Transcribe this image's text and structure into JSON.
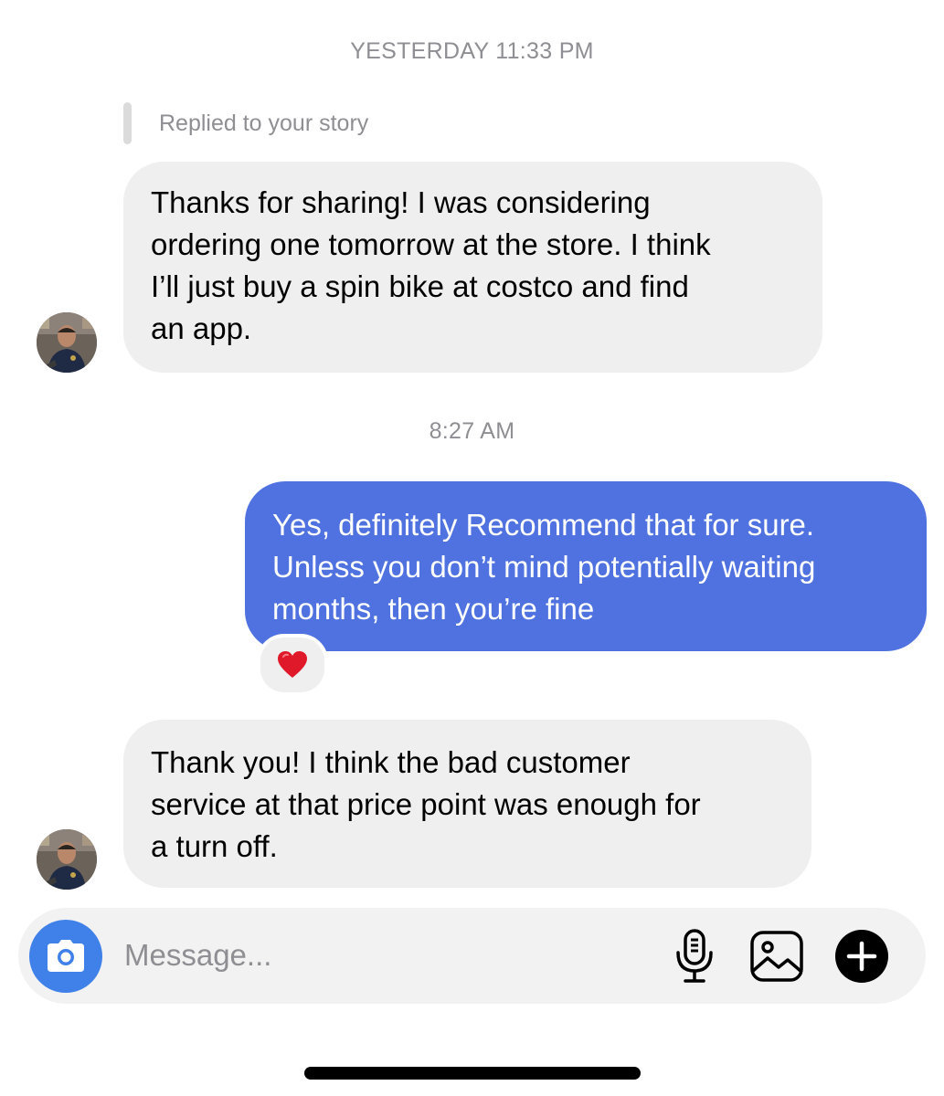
{
  "thread": {
    "timestamp_1": "YESTERDAY 11:33 PM",
    "reply_context": "Replied to your story",
    "timestamp_2": "8:27 AM"
  },
  "messages": [
    {
      "sender": "them",
      "text": "Thanks for sharing! I was considering\nordering one tomorrow at the store. I think\nI’ll just buy a spin bike at costco and find\nan app."
    },
    {
      "sender": "me",
      "text": "Yes, definitely Recommend that for sure.\nUnless you don’t mind potentially waiting\nmonths, then you’re fine",
      "reaction": "❤️"
    },
    {
      "sender": "them",
      "text": "Thank you! I think the bad customer\nservice at that price point was enough for\na turn off."
    }
  ],
  "composer": {
    "placeholder": "Message...",
    "camera_icon": "camera-icon",
    "mic_icon": "microphone-icon",
    "gallery_icon": "gallery-icon",
    "plus_icon": "plus-icon"
  },
  "colors": {
    "outgoing_bubble": "#4f72e0",
    "incoming_bubble": "#efefef",
    "camera_button": "#3f81e8",
    "timestamp_text": "#8e8e93"
  }
}
